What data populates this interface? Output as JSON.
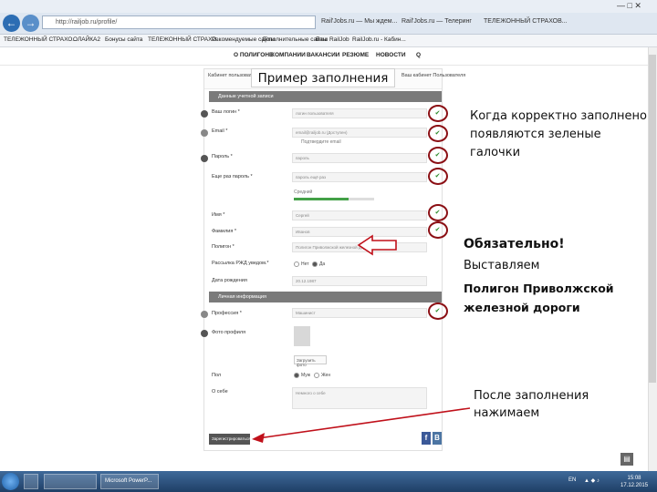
{
  "browser": {
    "address": "http://railjob.ru/profile/",
    "tab1": "Rail'Jobs.ru — Мы ждем...",
    "tab2": "Rail'Jobs.ru — Телеринг",
    "tab3": "ТЕЛЕЖОННЫЙ СТРАХОВ...",
    "window_controls": "— □ ✕",
    "back_icon": "arrow-left-icon",
    "forward_icon": "arrow-right-icon"
  },
  "favorites": [
    "ТЕЛЕЖОННЫЙ СТРАХО...",
    "ОЛАЙКА2",
    "Бонусы сайта",
    "ТЕЛЕЖОННЫЙ СТРАХО...",
    "Рекомендуемые сайты",
    "Дополнительные сайты",
    "Ваш RailJob",
    "RailJob.ru - Кабин..."
  ],
  "site_nav": [
    "О ПОЛИГОНЕ",
    "КОМПАНИИ",
    "ВАКАНСИИ",
    "РЕЗЮМЕ",
    "НОВОСТИ",
    "Q"
  ],
  "form": {
    "tab_left": "Кабинет пользователя",
    "tab_right": "Ваш кабинет Пользователя",
    "section1": "Данные учетной записи",
    "fields": [
      {
        "label": "Ваш логин *",
        "placeholder": "логин пользователя"
      },
      {
        "label": "Email *",
        "placeholder": "email@railjob.ru (Доступен)"
      },
      {
        "label": "Пароль *",
        "placeholder": "пароль"
      },
      {
        "label": "Еще раз пароль *",
        "placeholder": "пароль ещё раз"
      },
      {
        "label": "Имя *",
        "placeholder": "Сергей"
      },
      {
        "label": "Фамилия *",
        "placeholder": "Иванов"
      },
      {
        "label": "Полигон *",
        "placeholder": "Полигон Приволжской железной дороги"
      },
      {
        "label": "Рассылка РЖД уведом.*",
        "placeholder": ""
      },
      {
        "label": "Дата рождения",
        "placeholder": "20.12.1987"
      }
    ],
    "email_subnote": "Подтвердите email",
    "strength_label": "Средний",
    "strength_fraction": 0.68,
    "mailing_options": [
      "Нет",
      "Да"
    ],
    "section2": "Личная информация",
    "fields2": [
      {
        "label": "Профессия *",
        "placeholder": "Машинист"
      },
      {
        "label": "Фото профиля",
        "placeholder": ""
      },
      {
        "label": "Пол",
        "placeholder": ""
      },
      {
        "label": "О себе",
        "placeholder": "Немного о себе"
      }
    ],
    "upload_label": "Загрузить фото",
    "gender_options": [
      "Муж",
      "Жен"
    ],
    "submit_label": "Зарегистрироваться",
    "social_f": "f",
    "social_b": "В"
  },
  "annotations": {
    "title": "Пример заполнения",
    "note1": "Когда корректно заполнено появляются зеленые галочки",
    "note2_head": "Обязательно!",
    "note2_line": "Выставляем",
    "note2_bold": "Полигон Приволжской железной дороги",
    "note3": "После заполнения нажимаем"
  },
  "colors": {
    "ring": "#8b0f14",
    "check": "#2c8c2c",
    "arrow": "#c0101a"
  },
  "taskbar": {
    "item1": "",
    "item2": "Microsoft PowerP...",
    "tray": "EN",
    "time": "15:08",
    "date": "17.12.2015"
  }
}
